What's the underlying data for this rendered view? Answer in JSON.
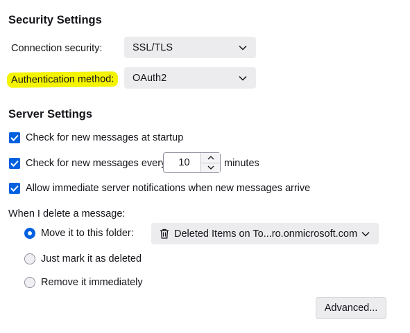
{
  "security": {
    "title": "Security Settings",
    "connection_label": "Connection security:",
    "connection_value": "SSL/TLS",
    "auth_label": "Authentication method:",
    "auth_value": "OAuth2",
    "highlight_color": "#f4f400"
  },
  "server": {
    "title": "Server Settings",
    "check_startup_label": "Check for new messages at startup",
    "check_startup_checked": true,
    "check_every_label": "Check for new messages every",
    "check_every_value": "10",
    "check_every_unit": "minutes",
    "check_every_checked": true,
    "allow_notifications_label": "Allow immediate server notifications when new messages arrive",
    "allow_notifications_checked": true
  },
  "delete": {
    "label": "When I delete a message:",
    "options": [
      {
        "label": "Move it to this folder:",
        "selected": true
      },
      {
        "label": "Just mark it as deleted",
        "selected": false
      },
      {
        "label": "Remove it immediately",
        "selected": false
      }
    ],
    "folder_value": "Deleted Items on To...ro.onmicrosoft.com",
    "folder_icon": "trash-icon"
  },
  "advanced_button": "Advanced...",
  "colors": {
    "accent": "#0061e0",
    "control_bg": "#ececef"
  }
}
